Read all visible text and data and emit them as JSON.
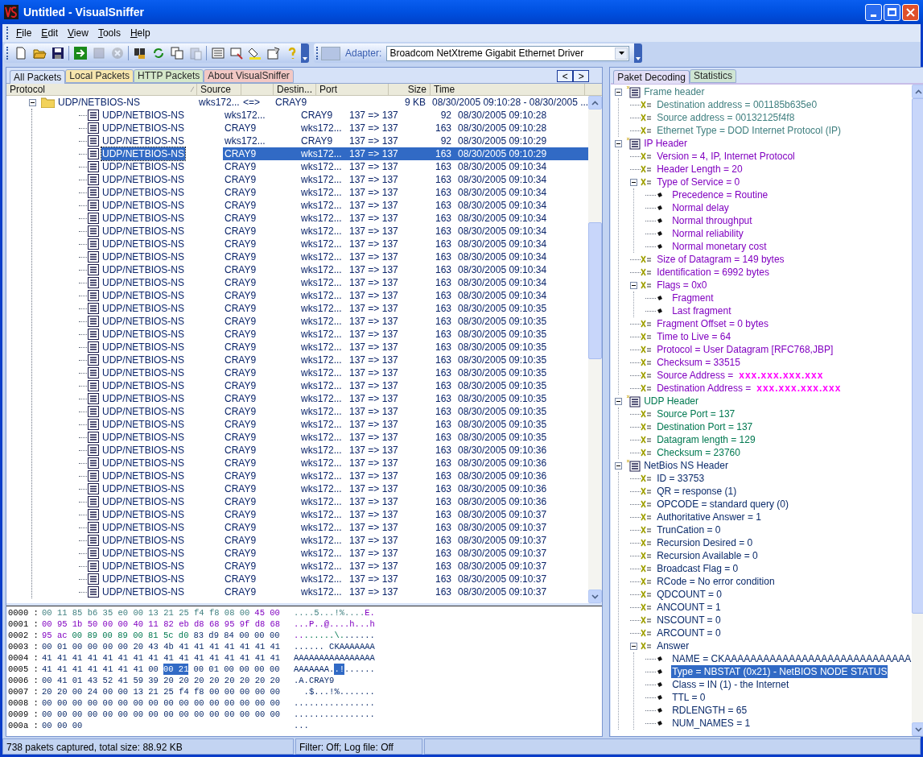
{
  "window": {
    "title": "Untitled - VisualSniffer"
  },
  "menu": [
    {
      "label": "File"
    },
    {
      "label": "Edit"
    },
    {
      "label": "View"
    },
    {
      "label": "Tools"
    },
    {
      "label": "Help"
    }
  ],
  "toolbar": [
    {
      "kind": "new",
      "disabled": false
    },
    {
      "kind": "open",
      "disabled": false
    },
    {
      "kind": "save",
      "disabled": false
    },
    {
      "kind": "sep"
    },
    {
      "kind": "start",
      "disabled": false
    },
    {
      "kind": "stop",
      "disabled": true
    },
    {
      "kind": "cancel",
      "disabled": true
    },
    {
      "kind": "sep"
    },
    {
      "kind": "find",
      "disabled": false
    },
    {
      "kind": "refresh",
      "disabled": false
    },
    {
      "kind": "copy",
      "disabled": false
    },
    {
      "kind": "paste",
      "disabled": true
    },
    {
      "kind": "sep"
    },
    {
      "kind": "list",
      "disabled": false
    },
    {
      "kind": "filter",
      "disabled": false
    },
    {
      "kind": "paint",
      "disabled": false
    },
    {
      "kind": "props",
      "disabled": false
    },
    {
      "kind": "help",
      "disabled": false
    }
  ],
  "adapter": {
    "label": "Adapter:",
    "value": "Broadcom NetXtreme Gigabit Ethernet Driver"
  },
  "packet_tabs": [
    {
      "label": "All Packets",
      "selected": true,
      "color": "#dce6f8"
    },
    {
      "label": "Local Packets",
      "selected": false,
      "color": "#fbe7a6"
    },
    {
      "label": "HTTP Packets",
      "selected": false,
      "color": "#d5e9c6"
    },
    {
      "label": "About VisualSniffer",
      "selected": false,
      "color": "#f6c6bf"
    }
  ],
  "nav": [
    "<",
    ">"
  ],
  "table": {
    "columns": [
      "Protocol",
      "Source",
      "",
      "Destin...",
      "Port",
      "Size",
      "Time"
    ],
    "sort_mark": "∕",
    "rows": [
      {
        "protocol": "UDP/NETBIOS-NS",
        "source": "wks172...",
        "direction": "<=>",
        "destination": "CRAY9",
        "port": "",
        "size": "9 KB",
        "time": "08/30/2005 09:10:28 - 08/30/2005 ...",
        "selected": false,
        "expanded": true,
        "children": [
          {
            "protocol": "UDP/NETBIOS-NS",
            "source": "wks172...",
            "destination": "CRAY9",
            "port": "137 => 137",
            "size": "92",
            "time": "08/30/2005 09:10:28",
            "selected": false
          },
          {
            "protocol": "UDP/NETBIOS-NS",
            "source": "CRAY9",
            "destination": "wks172...",
            "port": "137 => 137",
            "size": "163",
            "time": "08/30/2005 09:10:28",
            "selected": false
          },
          {
            "protocol": "UDP/NETBIOS-NS",
            "source": "wks172...",
            "destination": "CRAY9",
            "port": "137 => 137",
            "size": "92",
            "time": "08/30/2005 09:10:29",
            "selected": false
          },
          {
            "protocol": "UDP/NETBIOS-NS",
            "source": "CRAY9",
            "destination": "wks172...",
            "port": "137 => 137",
            "size": "163",
            "time": "08/30/2005 09:10:29",
            "selected": true
          },
          {
            "protocol": "UDP/NETBIOS-NS",
            "source": "CRAY9",
            "destination": "wks172...",
            "port": "137 => 137",
            "size": "163",
            "time": "08/30/2005 09:10:34",
            "selected": false
          },
          {
            "protocol": "UDP/NETBIOS-NS",
            "source": "CRAY9",
            "destination": "wks172...",
            "port": "137 => 137",
            "size": "163",
            "time": "08/30/2005 09:10:34",
            "selected": false
          },
          {
            "protocol": "UDP/NETBIOS-NS",
            "source": "CRAY9",
            "destination": "wks172...",
            "port": "137 => 137",
            "size": "163",
            "time": "08/30/2005 09:10:34",
            "selected": false
          },
          {
            "protocol": "UDP/NETBIOS-NS",
            "source": "CRAY9",
            "destination": "wks172...",
            "port": "137 => 137",
            "size": "163",
            "time": "08/30/2005 09:10:34",
            "selected": false
          },
          {
            "protocol": "UDP/NETBIOS-NS",
            "source": "CRAY9",
            "destination": "wks172...",
            "port": "137 => 137",
            "size": "163",
            "time": "08/30/2005 09:10:34",
            "selected": false
          },
          {
            "protocol": "UDP/NETBIOS-NS",
            "source": "CRAY9",
            "destination": "wks172...",
            "port": "137 => 137",
            "size": "163",
            "time": "08/30/2005 09:10:34",
            "selected": false
          },
          {
            "protocol": "UDP/NETBIOS-NS",
            "source": "CRAY9",
            "destination": "wks172...",
            "port": "137 => 137",
            "size": "163",
            "time": "08/30/2005 09:10:34",
            "selected": false
          },
          {
            "protocol": "UDP/NETBIOS-NS",
            "source": "CRAY9",
            "destination": "wks172...",
            "port": "137 => 137",
            "size": "163",
            "time": "08/30/2005 09:10:34",
            "selected": false
          },
          {
            "protocol": "UDP/NETBIOS-NS",
            "source": "CRAY9",
            "destination": "wks172...",
            "port": "137 => 137",
            "size": "163",
            "time": "08/30/2005 09:10:34",
            "selected": false
          },
          {
            "protocol": "UDP/NETBIOS-NS",
            "source": "CRAY9",
            "destination": "wks172...",
            "port": "137 => 137",
            "size": "163",
            "time": "08/30/2005 09:10:34",
            "selected": false
          },
          {
            "protocol": "UDP/NETBIOS-NS",
            "source": "CRAY9",
            "destination": "wks172...",
            "port": "137 => 137",
            "size": "163",
            "time": "08/30/2005 09:10:34",
            "selected": false
          },
          {
            "protocol": "UDP/NETBIOS-NS",
            "source": "CRAY9",
            "destination": "wks172...",
            "port": "137 => 137",
            "size": "163",
            "time": "08/30/2005 09:10:35",
            "selected": false
          },
          {
            "protocol": "UDP/NETBIOS-NS",
            "source": "CRAY9",
            "destination": "wks172...",
            "port": "137 => 137",
            "size": "163",
            "time": "08/30/2005 09:10:35",
            "selected": false
          },
          {
            "protocol": "UDP/NETBIOS-NS",
            "source": "CRAY9",
            "destination": "wks172...",
            "port": "137 => 137",
            "size": "163",
            "time": "08/30/2005 09:10:35",
            "selected": false
          },
          {
            "protocol": "UDP/NETBIOS-NS",
            "source": "CRAY9",
            "destination": "wks172...",
            "port": "137 => 137",
            "size": "163",
            "time": "08/30/2005 09:10:35",
            "selected": false
          },
          {
            "protocol": "UDP/NETBIOS-NS",
            "source": "CRAY9",
            "destination": "wks172...",
            "port": "137 => 137",
            "size": "163",
            "time": "08/30/2005 09:10:35",
            "selected": false
          },
          {
            "protocol": "UDP/NETBIOS-NS",
            "source": "CRAY9",
            "destination": "wks172...",
            "port": "137 => 137",
            "size": "163",
            "time": "08/30/2005 09:10:35",
            "selected": false
          },
          {
            "protocol": "UDP/NETBIOS-NS",
            "source": "CRAY9",
            "destination": "wks172...",
            "port": "137 => 137",
            "size": "163",
            "time": "08/30/2005 09:10:35",
            "selected": false
          },
          {
            "protocol": "UDP/NETBIOS-NS",
            "source": "CRAY9",
            "destination": "wks172...",
            "port": "137 => 137",
            "size": "163",
            "time": "08/30/2005 09:10:35",
            "selected": false
          },
          {
            "protocol": "UDP/NETBIOS-NS",
            "source": "CRAY9",
            "destination": "wks172...",
            "port": "137 => 137",
            "size": "163",
            "time": "08/30/2005 09:10:35",
            "selected": false
          },
          {
            "protocol": "UDP/NETBIOS-NS",
            "source": "CRAY9",
            "destination": "wks172...",
            "port": "137 => 137",
            "size": "163",
            "time": "08/30/2005 09:10:35",
            "selected": false
          },
          {
            "protocol": "UDP/NETBIOS-NS",
            "source": "CRAY9",
            "destination": "wks172...",
            "port": "137 => 137",
            "size": "163",
            "time": "08/30/2005 09:10:35",
            "selected": false
          },
          {
            "protocol": "UDP/NETBIOS-NS",
            "source": "CRAY9",
            "destination": "wks172...",
            "port": "137 => 137",
            "size": "163",
            "time": "08/30/2005 09:10:36",
            "selected": false
          },
          {
            "protocol": "UDP/NETBIOS-NS",
            "source": "CRAY9",
            "destination": "wks172...",
            "port": "137 => 137",
            "size": "163",
            "time": "08/30/2005 09:10:36",
            "selected": false
          },
          {
            "protocol": "UDP/NETBIOS-NS",
            "source": "CRAY9",
            "destination": "wks172...",
            "port": "137 => 137",
            "size": "163",
            "time": "08/30/2005 09:10:36",
            "selected": false
          },
          {
            "protocol": "UDP/NETBIOS-NS",
            "source": "CRAY9",
            "destination": "wks172...",
            "port": "137 => 137",
            "size": "163",
            "time": "08/30/2005 09:10:36",
            "selected": false
          },
          {
            "protocol": "UDP/NETBIOS-NS",
            "source": "CRAY9",
            "destination": "wks172...",
            "port": "137 => 137",
            "size": "163",
            "time": "08/30/2005 09:10:36",
            "selected": false
          },
          {
            "protocol": "UDP/NETBIOS-NS",
            "source": "CRAY9",
            "destination": "wks172...",
            "port": "137 => 137",
            "size": "163",
            "time": "08/30/2005 09:10:37",
            "selected": false
          },
          {
            "protocol": "UDP/NETBIOS-NS",
            "source": "CRAY9",
            "destination": "wks172...",
            "port": "137 => 137",
            "size": "163",
            "time": "08/30/2005 09:10:37",
            "selected": false
          },
          {
            "protocol": "UDP/NETBIOS-NS",
            "source": "CRAY9",
            "destination": "wks172...",
            "port": "137 => 137",
            "size": "163",
            "time": "08/30/2005 09:10:37",
            "selected": false
          },
          {
            "protocol": "UDP/NETBIOS-NS",
            "source": "CRAY9",
            "destination": "wks172...",
            "port": "137 => 137",
            "size": "163",
            "time": "08/30/2005 09:10:37",
            "selected": false
          },
          {
            "protocol": "UDP/NETBIOS-NS",
            "source": "CRAY9",
            "destination": "wks172...",
            "port": "137 => 137",
            "size": "163",
            "time": "08/30/2005 09:10:37",
            "selected": false
          },
          {
            "protocol": "UDP/NETBIOS-NS",
            "source": "CRAY9",
            "destination": "wks172...",
            "port": "137 => 137",
            "size": "163",
            "time": "08/30/2005 09:10:37",
            "selected": false
          },
          {
            "protocol": "UDP/NETBIOS-NS",
            "source": "CRAY9",
            "destination": "wks172...",
            "port": "137 => 137",
            "size": "163",
            "time": "08/30/2005 09:10:37",
            "selected": false
          }
        ]
      }
    ]
  },
  "hex_dump": [
    {
      "offset": "0000 :",
      "hex": [
        {
          "text": "00 11 85 b6 35 e0 00 13 21 25 f4 f8 08 00",
          "kind": "ethernet",
          "selected": false
        },
        {
          "text": "45 00",
          "kind": "ip",
          "selected": false
        }
      ],
      "ascii": [
        {
          "text": "....5...!%....",
          "kind": "ethernet",
          "selected": false
        },
        {
          "text": "E.",
          "kind": "ip",
          "selected": false
        }
      ]
    },
    {
      "offset": "0001 :",
      "hex": [
        {
          "text": "00 95 1b 50 00 00 40 11 82 eb d8 68 95 9f d8 68",
          "kind": "ip",
          "selected": false
        }
      ],
      "ascii": [
        {
          "text": "...P..@....h...h",
          "kind": "ip",
          "selected": false
        }
      ]
    },
    {
      "offset": "0002 :",
      "hex": [
        {
          "text": "95 ac",
          "kind": "ip",
          "selected": false
        },
        {
          "text": "00 89 00 89 00 81 5c d0",
          "kind": "udp",
          "selected": false
        },
        {
          "text": "83 d9 84 00 00 00",
          "kind": "netbios",
          "selected": false
        }
      ],
      "ascii": [
        {
          "text": "..",
          "kind": "ip",
          "selected": false
        },
        {
          "text": "......\\.",
          "kind": "udp",
          "selected": false
        },
        {
          "text": "......",
          "kind": "netbios",
          "selected": false
        }
      ]
    },
    {
      "offset": "0003 :",
      "hex": [
        {
          "text": "00 01 00 00 00 00 20 43 4b 41 41 41 41 41 41 41",
          "kind": "netbios",
          "selected": false
        }
      ],
      "ascii": [
        {
          "text": "...... CKAAAAAAA",
          "kind": "netbios",
          "selected": false
        }
      ]
    },
    {
      "offset": "0004 :",
      "hex": [
        {
          "text": "41 41 41 41 41 41 41 41 41 41 41 41 41 41 41 41",
          "kind": "netbios",
          "selected": false
        }
      ],
      "ascii": [
        {
          "text": "AAAAAAAAAAAAAAAA",
          "kind": "netbios",
          "selected": false
        }
      ]
    },
    {
      "offset": "0005 :",
      "hex": [
        {
          "text": "41 41 41 41 41 41 41 00",
          "kind": "netbios",
          "selected": false
        },
        {
          "text": "00 21",
          "selected": true
        },
        {
          "text": "00 01 00 00 00 00",
          "kind": "netbios",
          "selected": false
        }
      ],
      "ascii": [
        {
          "text": "AAAAAAA.",
          "kind": "netbios",
          "selected": false
        },
        {
          "text": ".!",
          "selected": true
        },
        {
          "text": "......",
          "kind": "netbios",
          "selected": false
        }
      ]
    },
    {
      "offset": "0006 :",
      "hex": [
        {
          "text": "00 41 01 43 52 41 59 39 20 20 20 20 20 20 20 20",
          "kind": "netbios",
          "selected": false
        }
      ],
      "ascii": [
        {
          "text": ".A.CRAY9",
          "kind": "netbios",
          "selected": false
        }
      ]
    },
    {
      "offset": "0007 :",
      "hex": [
        {
          "text": "20 20 00 24 00 00 13 21 25 f4 f8 00 00 00 00 00",
          "kind": "netbios",
          "selected": false
        }
      ],
      "ascii": [
        {
          "text": "  .$...!%.......",
          "kind": "netbios",
          "selected": false
        }
      ]
    },
    {
      "offset": "0008 :",
      "hex": [
        {
          "text": "00 00 00 00 00 00 00 00 00 00 00 00 00 00 00 00",
          "kind": "netbios",
          "selected": false
        }
      ],
      "ascii": [
        {
          "text": "................",
          "kind": "netbios",
          "selected": false
        }
      ]
    },
    {
      "offset": "0009 :",
      "hex": [
        {
          "text": "00 00 00 00 00 00 00 00 00 00 00 00 00 00 00 00",
          "kind": "netbios",
          "selected": false
        }
      ],
      "ascii": [
        {
          "text": "................",
          "kind": "netbios",
          "selected": false
        }
      ]
    },
    {
      "offset": "000a :",
      "hex": [
        {
          "text": "00 00 00",
          "kind": "netbios",
          "selected": false
        }
      ],
      "ascii": [
        {
          "text": "...",
          "kind": "netbios",
          "selected": false
        }
      ]
    }
  ],
  "decode_tabs": [
    {
      "label": "Paket Decoding",
      "selected": true,
      "color": "#e2def6"
    },
    {
      "label": "Statistics",
      "selected": false,
      "color": "#cfe6cf"
    }
  ],
  "decode_tree": [
    {
      "kind": "section",
      "text": "Frame header",
      "color": "#3f7f7f",
      "expanded": true,
      "selected": false,
      "children": [
        {
          "kind": "field",
          "text": "Destination address = 001185b635e0",
          "selected": false
        },
        {
          "kind": "field",
          "text": "Source address = 00132125f4f8",
          "selected": false
        },
        {
          "kind": "field",
          "text": "Ethernet Type = DOD Internet Protocol (IP)",
          "selected": false
        }
      ]
    },
    {
      "kind": "section",
      "text": "IP Header",
      "color": "#8000c0",
      "expanded": true,
      "selected": false,
      "children": [
        {
          "kind": "field",
          "text": "Version = 4, IP, Internet Protocol",
          "selected": false
        },
        {
          "kind": "field",
          "text": "Header Length = 20",
          "selected": false
        },
        {
          "kind": "field",
          "text": "Type of Service = 0",
          "expanded": true,
          "selected": false,
          "children": [
            {
              "kind": "bullet",
              "text": "Precedence = Routine",
              "selected": false
            },
            {
              "kind": "bullet",
              "text": "Normal delay",
              "selected": false
            },
            {
              "kind": "bullet",
              "text": "Normal throughput",
              "selected": false
            },
            {
              "kind": "bullet",
              "text": "Normal reliability",
              "selected": false
            },
            {
              "kind": "bullet",
              "text": "Normal monetary cost",
              "selected": false
            }
          ]
        },
        {
          "kind": "field",
          "text": "Size of Datagram = 149 bytes",
          "selected": false
        },
        {
          "kind": "field",
          "text": "Identification = 6992 bytes",
          "selected": false
        },
        {
          "kind": "field",
          "text": "Flags = 0x0",
          "expanded": true,
          "selected": false,
          "children": [
            {
              "kind": "bullet",
              "text": "Fragment",
              "selected": false
            },
            {
              "kind": "bullet",
              "text": "Last fragment",
              "selected": false
            }
          ]
        },
        {
          "kind": "field",
          "text": "Fragment Offset = 0 bytes",
          "selected": false
        },
        {
          "kind": "field",
          "text": "Time to Live = 64",
          "selected": false
        },
        {
          "kind": "field",
          "text": "Protocol = User Datagram [RFC768,JBP]",
          "selected": false
        },
        {
          "kind": "field",
          "text": "Checksum = 33515",
          "selected": false
        },
        {
          "kind": "field",
          "text": "Source Address =",
          "masked_value": "xxx.xxx.xxx.xxx",
          "selected": false
        },
        {
          "kind": "field",
          "text": "Destination Address =",
          "masked_value": "xxx.xxx.xxx.xxx",
          "selected": false
        }
      ]
    },
    {
      "kind": "section",
      "text": "UDP Header",
      "color": "#007850",
      "expanded": true,
      "selected": false,
      "children": [
        {
          "kind": "field",
          "text": "Source Port = 137",
          "selected": false
        },
        {
          "kind": "field",
          "text": "Destination Port = 137",
          "selected": false
        },
        {
          "kind": "field",
          "text": "Datagram length = 129",
          "selected": false
        },
        {
          "kind": "field",
          "text": "Checksum = 23760",
          "selected": false
        }
      ]
    },
    {
      "kind": "section",
      "text": "NetBios NS Header",
      "color": "#0a2a6a",
      "expanded": true,
      "selected": false,
      "children": [
        {
          "kind": "field",
          "text": "ID = 33753",
          "selected": false
        },
        {
          "kind": "field",
          "text": "QR = response (1)",
          "selected": false
        },
        {
          "kind": "field",
          "text": "OPCODE = standard query (0)",
          "selected": false
        },
        {
          "kind": "field",
          "text": "Authoritative Answer = 1",
          "selected": false
        },
        {
          "kind": "field",
          "text": "TrunCation = 0",
          "selected": false
        },
        {
          "kind": "field",
          "text": "Recursion Desired = 0",
          "selected": false
        },
        {
          "kind": "field",
          "text": "Recursion Available = 0",
          "selected": false
        },
        {
          "kind": "field",
          "text": "Broadcast Flag = 0",
          "selected": false
        },
        {
          "kind": "field",
          "text": "RCode = No error condition",
          "selected": false
        },
        {
          "kind": "field",
          "text": "QDCOUNT = 0",
          "selected": false
        },
        {
          "kind": "field",
          "text": "ANCOUNT = 1",
          "selected": false
        },
        {
          "kind": "field",
          "text": "NSCOUNT = 0",
          "selected": false
        },
        {
          "kind": "field",
          "text": "ARCOUNT = 0",
          "selected": false
        },
        {
          "kind": "field",
          "text": "Answer",
          "expanded": true,
          "selected": false,
          "children": [
            {
              "kind": "bullet",
              "text": "NAME = CKAAAAAAAAAAAAAAAAAAAAAAAAAAAAA",
              "selected": false
            },
            {
              "kind": "bullet",
              "text": "Type = NBSTAT (0x21) - NetBIOS NODE STATUS",
              "selected": true
            },
            {
              "kind": "bullet",
              "text": "Class = IN (1) - the Internet",
              "selected": false
            },
            {
              "kind": "bullet",
              "text": "TTL = 0",
              "selected": false
            },
            {
              "kind": "bullet",
              "text": "RDLENGTH = 65",
              "selected": false
            },
            {
              "kind": "bullet",
              "text": "NUM_NAMES = 1",
              "selected": false
            }
          ]
        }
      ]
    }
  ],
  "status_bar": [
    "738 pakets captured, total size: 88.92 KB",
    "Filter: Off; Log file: Off"
  ]
}
